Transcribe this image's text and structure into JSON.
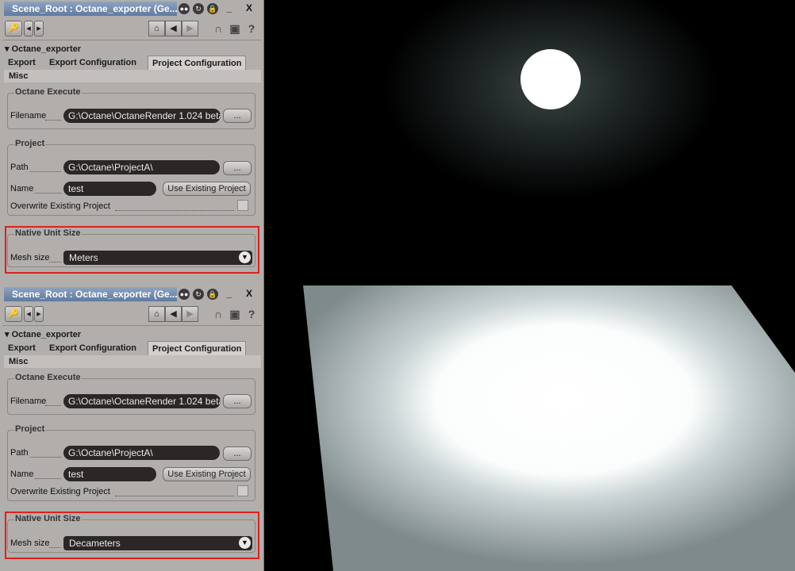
{
  "panels": [
    {
      "title": "Scene_Root : Octane_exporter (Ge...",
      "titlebar_buttons": {
        "minimize": "_",
        "close": "X"
      },
      "section": "Octane_exporter",
      "tabs": [
        "Export",
        "Export Configuration",
        "Project Configuration"
      ],
      "active_tab": "Project Configuration",
      "misc_tab": "Misc",
      "octane_execute": {
        "title": "Octane Execute",
        "filename_label": "Filename",
        "filename_value": "G:\\Octane\\OctaneRender 1.024 beta",
        "browse": "..."
      },
      "project": {
        "title": "Project",
        "path_label": "Path",
        "path_value": "G:\\Octane\\ProjectA\\",
        "browse": "...",
        "name_label": "Name",
        "name_value": "test",
        "use_existing": "Use Existing Project",
        "overwrite_label": "Overwrite Existing Project"
      },
      "native_unit": {
        "title": "Native Unit Size",
        "mesh_label": "Mesh size",
        "mesh_value": "Meters"
      }
    },
    {
      "title": "Scene_Root : Octane_exporter (Ge...",
      "titlebar_buttons": {
        "minimize": "_",
        "close": "X"
      },
      "section": "Octane_exporter",
      "tabs": [
        "Export",
        "Export Configuration",
        "Project Configuration"
      ],
      "active_tab": "Project Configuration",
      "misc_tab": "Misc",
      "octane_execute": {
        "title": "Octane Execute",
        "filename_label": "Filename",
        "filename_value": "G:\\Octane\\OctaneRender 1.024 beta",
        "browse": "..."
      },
      "project": {
        "title": "Project",
        "path_label": "Path",
        "path_value": "G:\\Octane\\ProjectA\\",
        "browse": "...",
        "name_label": "Name",
        "name_value": "test",
        "use_existing": "Use Existing Project",
        "overwrite_label": "Overwrite Existing Project"
      },
      "native_unit": {
        "title": "Native Unit Size",
        "mesh_label": "Mesh size",
        "mesh_value": "Decameters"
      }
    }
  ],
  "colors": {
    "panel_bg": "#b1aeac",
    "highlight_box": "#e02020",
    "field_bg": "#2a2726",
    "title_bg": "#6f87aa"
  }
}
